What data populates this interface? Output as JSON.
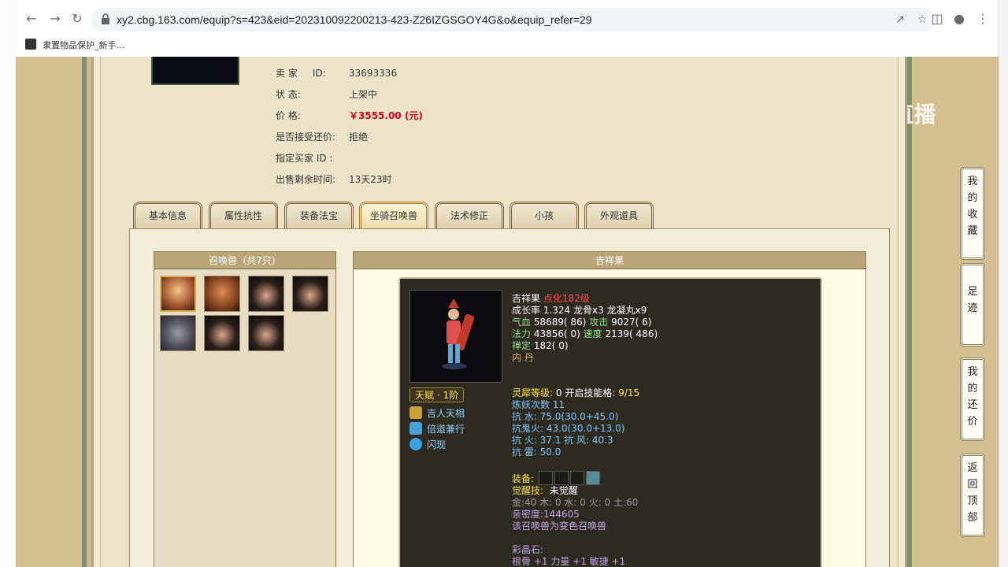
{
  "browser": {
    "url": "xy2.cbg.163.com/equip?s=423&eid=202310092200213-423-Z26IZGSGOY4G&o&equip_refer=29",
    "bookmark_label": "隶置物品保护_新手..."
  },
  "watermark": "CC直播",
  "seller": {
    "seller_label": "卖    家",
    "id_label": "ID:",
    "id_value": "33693336",
    "status_label": "状        态:",
    "status_value": "上架中",
    "price_label": "价        格:",
    "price_value": "￥3555.00 (元)",
    "bargain_label": "是否接受还价:",
    "bargain_value": "拒绝",
    "buyer_label": "指定买家 ID :",
    "remaining_label": "出售剩余时间:",
    "remaining_value": "13天23时"
  },
  "tabs": [
    "基本信息",
    "属性抗性",
    "装备法宝",
    "坐骑召唤兽",
    "法术修正",
    "小孩",
    "外观道具"
  ],
  "active_tab": "坐骑召唤兽",
  "pet_list": {
    "title": "召唤兽（共7只）"
  },
  "detail": {
    "title": "吉祥果",
    "name": "吉祥果",
    "level": "点化182级",
    "growth_line": "成长率 1.324 龙骨x3 龙凝丸x9",
    "hp_label": "气血",
    "hp": "58689( 86)",
    "atk_label": "攻击",
    "atk": "9027( 6)",
    "mp_label": "法力",
    "mp": "43856( 0)",
    "spd_label": "速度",
    "spd": "2139( 486)",
    "zen_label": "禅定",
    "zen": "182( 0)",
    "neidan": "内  丹",
    "talent": "天赋 · 1阶",
    "skills": [
      "吉人天相",
      "倍道兼行",
      "闪现"
    ],
    "spirit_line_a": "灵犀等级:",
    "spirit_line_b": "0 开启技能格:",
    "spirit_line_c": "9/15",
    "refine": "炼妖次数 11",
    "res_water": "抗    水: 75.0(30.0+45.0)",
    "res_ghost": "抗鬼火: 43.0(30.0+13.0)",
    "res_fire_wind": "抗    火: 37.1 抗    风: 40.3",
    "res_thunder": "抗    雷: 50.0",
    "equip_label": "装备:",
    "awaken_label": "觉醒技:",
    "awaken_value": "未觉醒",
    "elements": "金:40 木: 0 水: 0 火: 0 土:60",
    "intimacy": "亲密度:144605",
    "variant": "该召唤兽为变色召唤兽",
    "crystal_label": "彩晶石:",
    "crystal_value": "根骨 +1 力量 +1 敏捷 +1"
  },
  "side_buttons": [
    {
      "label": "我的收藏"
    },
    {
      "label": "足迹"
    },
    {
      "label": "我的还价"
    },
    {
      "label": "返回顶部"
    }
  ]
}
